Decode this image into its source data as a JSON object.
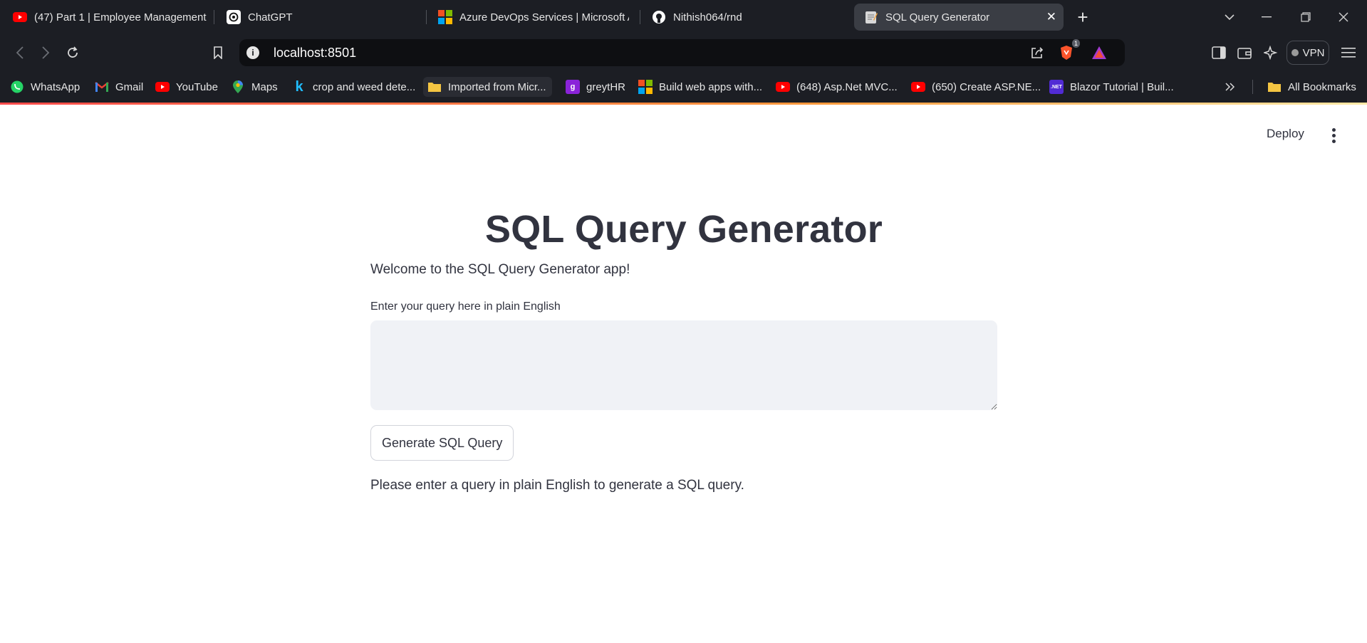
{
  "tabs": [
    {
      "title": "(47) Part 1 | Employee Management",
      "favicon": "youtube-icon"
    },
    {
      "title": "ChatGPT",
      "favicon": "chatgpt-icon"
    },
    {
      "title": "Azure DevOps Services | Microsoft Azure",
      "favicon": "microsoft-icon"
    },
    {
      "title": "Nithish064/rnd",
      "favicon": "github-icon"
    },
    {
      "title": "SQL Query Generator",
      "favicon": "memo-icon",
      "active": true
    }
  ],
  "address_bar": {
    "url": "localhost:8501"
  },
  "extensions": {
    "brave_badge": "1",
    "vpn_label": "VPN"
  },
  "bookmarks": [
    {
      "label": "WhatsApp",
      "icon": "whatsapp-icon"
    },
    {
      "label": "Gmail",
      "icon": "gmail-icon"
    },
    {
      "label": "YouTube",
      "icon": "youtube-icon"
    },
    {
      "label": "Maps",
      "icon": "maps-icon"
    },
    {
      "label": "crop and weed dete...",
      "icon": "kaggle-icon"
    },
    {
      "label": "Imported from Micr...",
      "icon": "folder-icon"
    },
    {
      "label": "greytHR",
      "icon": "greythr-icon"
    },
    {
      "label": "Build web apps with...",
      "icon": "microsoft-icon"
    },
    {
      "label": "(648) Asp.Net MVC...",
      "icon": "youtube-icon"
    },
    {
      "label": "(650) Create ASP.NE...",
      "icon": "youtube-icon"
    },
    {
      "label": "Blazor Tutorial | Buil...",
      "icon": "dotnet-icon"
    }
  ],
  "all_bookmarks_label": "All Bookmarks",
  "app": {
    "deploy_label": "Deploy",
    "title": "SQL Query Generator",
    "welcome": "Welcome to the SQL Query Generator app!",
    "input_label": "Enter your query here in plain English",
    "input_value": "",
    "button_label": "Generate SQL Query",
    "info_message": "Please enter a query in plain English to generate a SQL query."
  },
  "colors": {
    "browser_chrome": "#1c1e24",
    "text_primary": "#31333f",
    "input_bg": "#f0f2f6",
    "accent": "#ff4b4b"
  }
}
